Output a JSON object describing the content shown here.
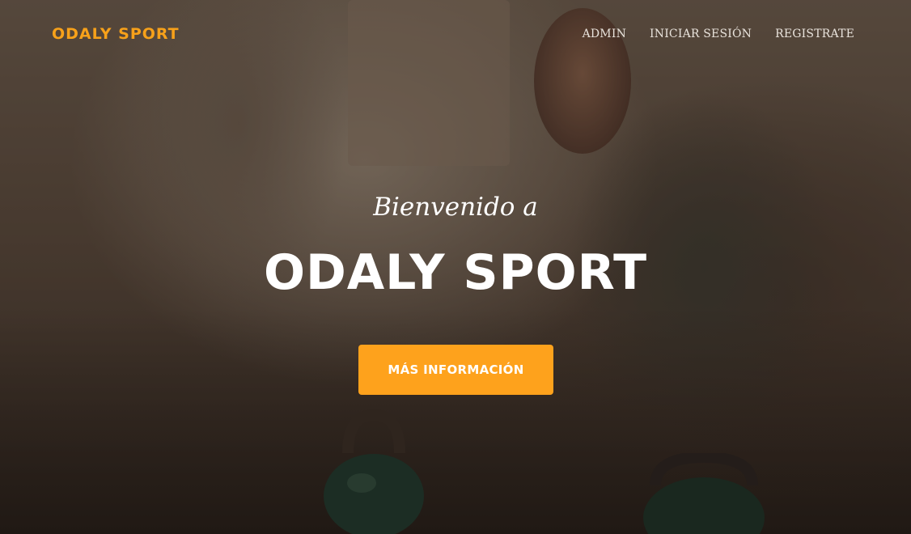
{
  "nav": {
    "brand": "ODALY SPORT",
    "links": [
      {
        "label": "ADMIN"
      },
      {
        "label": "INICIAR SESIÓN"
      },
      {
        "label": "REGISTRATE"
      }
    ]
  },
  "hero": {
    "subheading": "Bienvenido a",
    "heading": "ODALY SPORT",
    "cta_label": "MÁS INFORMACIÓN"
  },
  "colors": {
    "accent": "#fea21c",
    "brand": "#f7a11a",
    "text": "#ffffff"
  }
}
